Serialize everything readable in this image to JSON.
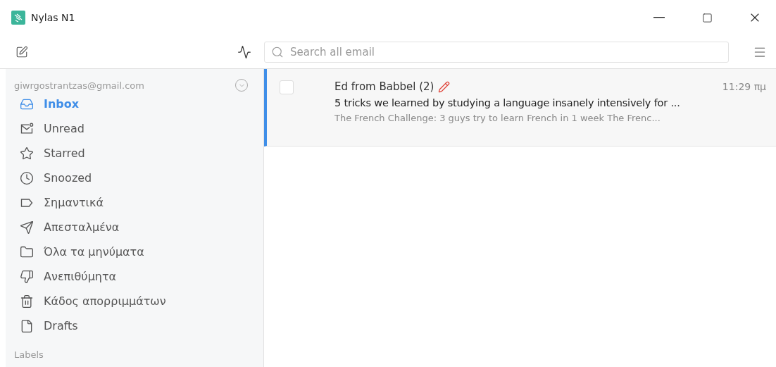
{
  "window": {
    "title": "Nylas N1"
  },
  "search": {
    "placeholder": "Search all email"
  },
  "sidebar": {
    "account": "giwrgostrantzas@gmail.com",
    "items": [
      {
        "label": "Inbox",
        "kind": "inbox",
        "selected": true
      },
      {
        "label": "Unread",
        "kind": "unread",
        "selected": false
      },
      {
        "label": "Starred",
        "kind": "starred",
        "selected": false
      },
      {
        "label": "Snoozed",
        "kind": "snoozed",
        "selected": false
      },
      {
        "label": "Σημαντικά",
        "kind": "important",
        "selected": false
      },
      {
        "label": "Απεσταλμένα",
        "kind": "sent",
        "selected": false
      },
      {
        "label": "Όλα τα μηνύματα",
        "kind": "all",
        "selected": false
      },
      {
        "label": "Ανεπιθύμητα",
        "kind": "spam",
        "selected": false
      },
      {
        "label": "Κάδος απορριμμάτων",
        "kind": "trash",
        "selected": false
      },
      {
        "label": "Drafts",
        "kind": "drafts",
        "selected": false
      }
    ],
    "section": "Labels"
  },
  "messages": [
    {
      "sender": "Ed from Babbel (2)",
      "draft": true,
      "time": "11:29 πμ",
      "subject": "5 tricks we learned by studying a language insanely intensively for ...",
      "snippet": "The French Challenge: 3 guys try to learn French in 1 week The Frenc...",
      "selected": true,
      "checked": false
    }
  ]
}
